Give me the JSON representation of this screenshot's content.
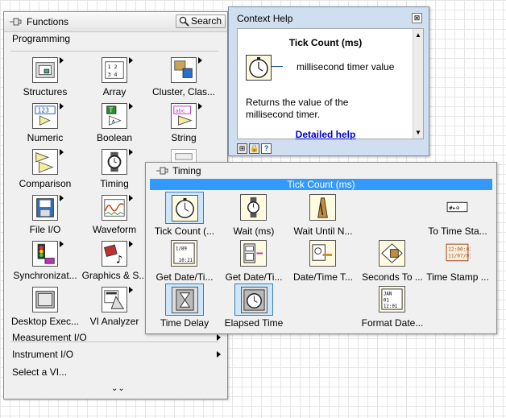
{
  "functions": {
    "title": "Functions",
    "search_label": "Search",
    "category": "Programming",
    "palette": [
      {
        "label": "Structures",
        "icon": "structures-icon"
      },
      {
        "label": "Array",
        "icon": "array-icon"
      },
      {
        "label": "Cluster, Clas...",
        "icon": "cluster-icon"
      },
      {
        "label": "Numeric",
        "icon": "numeric-icon"
      },
      {
        "label": "Boolean",
        "icon": "boolean-icon"
      },
      {
        "label": "String",
        "icon": "string-icon"
      },
      {
        "label": "Comparison",
        "icon": "comparison-icon"
      },
      {
        "label": "Timing",
        "icon": "timing-icon"
      },
      {
        "label": "File I/O",
        "icon": "file-io-icon"
      },
      {
        "label": "Waveform",
        "icon": "waveform-icon"
      },
      {
        "label": "Synchronizat...",
        "icon": "synchronization-icon"
      },
      {
        "label": "Graphics & S...",
        "icon": "graphics-sound-icon"
      },
      {
        "label": "Desktop Exec...",
        "icon": "desktop-execution-icon"
      },
      {
        "label": "VI Analyzer",
        "icon": "vi-analyzer-icon"
      }
    ],
    "menu": [
      {
        "label": "Measurement I/O"
      },
      {
        "label": "Instrument I/O"
      },
      {
        "label": "Select a VI..."
      }
    ],
    "more_glyph": "⌄⌄"
  },
  "context_help": {
    "title": "Context Help",
    "close_glyph": "⊠",
    "heading": "Tick Count (ms)",
    "terminal_label": "millisecond timer value",
    "description": "Returns the value of the millisecond timer.",
    "link": "Detailed help"
  },
  "timing": {
    "title": "Timing",
    "highlight": "Tick Count (ms)",
    "items": [
      {
        "label": "Tick Count (...",
        "icon": "tick-count-icon"
      },
      {
        "label": "Wait (ms)",
        "icon": "wait-icon"
      },
      {
        "label": "Wait Until N...",
        "icon": "wait-until-icon"
      },
      {
        "label": "To Time Sta...",
        "icon": "to-time-stamp-icon"
      },
      {
        "label": "Get Date/Ti...",
        "icon": "get-date-time-icon"
      },
      {
        "label": "Get Date/Ti...",
        "icon": "get-date-time-string-icon"
      },
      {
        "label": "Date/Time T...",
        "icon": "date-time-to-seconds-icon"
      },
      {
        "label": "Seconds To ...",
        "icon": "seconds-to-date-time-icon"
      },
      {
        "label": "Time Stamp ...",
        "icon": "time-stamp-constant-icon"
      },
      {
        "label": "Time Delay",
        "icon": "time-delay-icon"
      },
      {
        "label": "Elapsed Time",
        "icon": "elapsed-time-icon"
      },
      {
        "label": "Format Date...",
        "icon": "format-date-time-icon"
      }
    ]
  },
  "colors": {
    "highlight_bar": "#3399ff",
    "context_frame": "#cfdff0",
    "link": "#0000cc",
    "timing_icon_bg": "#fffbe0"
  }
}
